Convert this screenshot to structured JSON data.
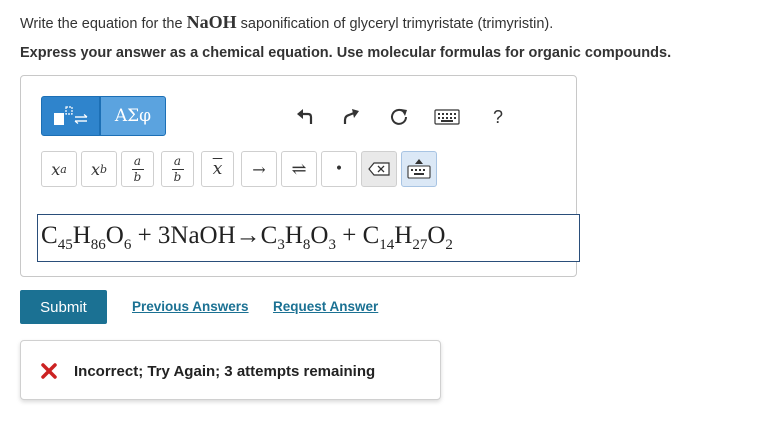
{
  "question": {
    "prompt_before": "Write the equation for the ",
    "prompt_chem": "NaOH",
    "prompt_after": " saponification of glyceryl trimyristate (trimyristin).",
    "instruction": "Express your answer as a chemical equation. Use molecular formulas for organic compounds."
  },
  "toolbar": {
    "greek_label": "ΑΣφ",
    "help_label": "?",
    "icons": [
      "template-icon",
      "undo-icon",
      "redo-icon",
      "reset-icon",
      "keyboard-icon",
      "help-icon"
    ]
  },
  "palette": {
    "superscript_base": "x",
    "superscript_exp": "a",
    "subscript_base": "x",
    "subscript_sub": "b",
    "fraction_num": "a",
    "fraction_den": "b",
    "mixed_num": "a",
    "mixed_den": "b",
    "vector_label": "x",
    "arrow_label": "→",
    "equilibrium_label": "⇌",
    "dot_label": "•"
  },
  "answer": {
    "t1": "C",
    "s1": "45",
    "t2": "H",
    "s2": "86",
    "t3": "O",
    "s3": "6",
    "t4": " + 3NaOH→C",
    "s4": "3",
    "t5": "H",
    "s5": "8",
    "t6": "O",
    "s6": "3",
    "t7": " + C",
    "s7": "14",
    "t8": "H",
    "s8": "27",
    "t9": "O",
    "s9": "2"
  },
  "actions": {
    "submit_label": "Submit",
    "previous_answers_label": "Previous Answers",
    "request_answer_label": "Request Answer"
  },
  "feedback": {
    "message": "Incorrect; Try Again; 3 attempts remaining"
  },
  "colors": {
    "accent_blue": "#2f84cc",
    "submit_teal": "#1b7193",
    "error_red": "#cc2222"
  }
}
